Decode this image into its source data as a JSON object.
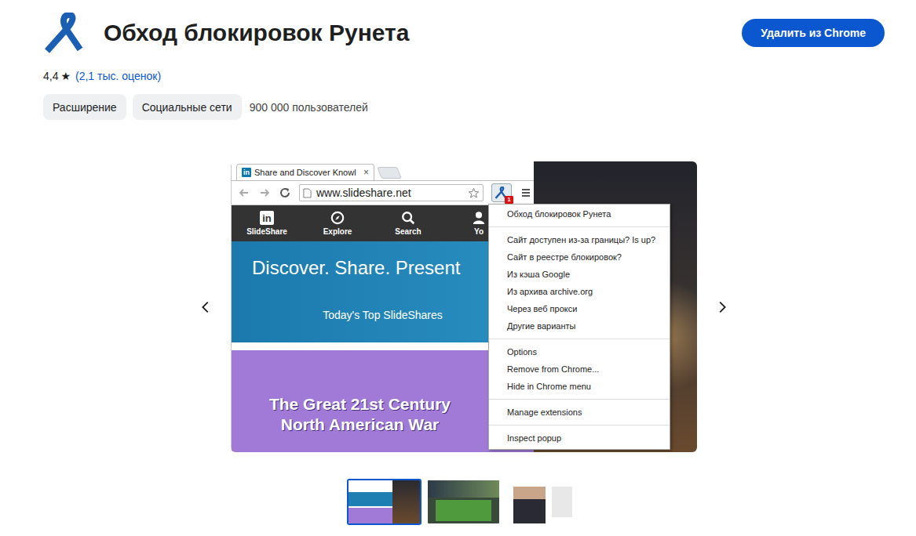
{
  "header": {
    "title": "Обход блокировок Рунета",
    "remove_button": "Удалить из Chrome"
  },
  "rating": {
    "value": "4,4",
    "star": "★",
    "count": "(2,1 тыс. оценок)"
  },
  "chips": [
    {
      "label": "Расширение"
    },
    {
      "label": "Социальные сети"
    }
  ],
  "users": "900 000 пользователей",
  "slide": {
    "browser": {
      "tab": {
        "favicon": "in",
        "title": "Share and Discover Knowl",
        "close": "×"
      },
      "url": "www.slideshare.net",
      "badge": "1",
      "nav": [
        {
          "label": "SlideShare",
          "kind": "logo",
          "logo": "in"
        },
        {
          "label": "Explore",
          "kind": "explore"
        },
        {
          "label": "Search",
          "kind": "search"
        },
        {
          "label": "Yo",
          "kind": "user"
        }
      ],
      "hero": {
        "title": "Discover. Share. Present",
        "subtitle": "Today's Top SlideShares"
      },
      "promo": {
        "lines": [
          "The Great 21st Century",
          "North American War"
        ]
      }
    },
    "menu": {
      "title": "Обход блокировок Рунета",
      "sections": [
        [
          "Сайт доступен из-за границы? Is up?",
          "Сайт в реестре блокировок?",
          "Из кэша Google",
          "Из архива archive.org",
          "Через веб прокси",
          "Другие варианты"
        ],
        [
          "Options",
          "Remove from Chrome...",
          "Hide in Chrome menu"
        ],
        [
          "Manage extensions"
        ],
        [
          "Inspect popup"
        ]
      ]
    }
  },
  "thumbnails": [
    {
      "kind": "slideshare",
      "selected": true
    },
    {
      "kind": "green",
      "selected": false
    },
    {
      "kind": "portrait",
      "selected": false
    }
  ]
}
